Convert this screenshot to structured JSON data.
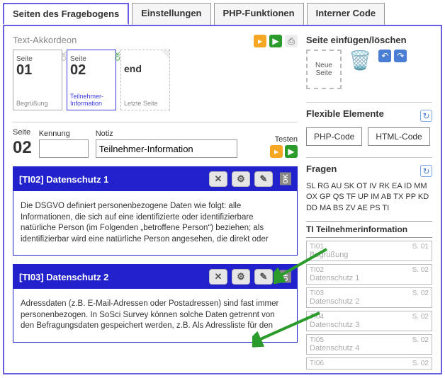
{
  "tabs": [
    "Seiten des Fragebogens",
    "Einstellungen",
    "PHP-Funktionen",
    "Interner Code"
  ],
  "accordion_label": "Text-Akkordeon",
  "pages": [
    {
      "label": "Seite",
      "num": "01",
      "name": "Begrüßung",
      "ok": "OK"
    },
    {
      "label": "Seite",
      "num": "02",
      "name": "Teilnehmer-Information",
      "ok": "OK"
    },
    {
      "label": "end",
      "num": "",
      "name": "Letzte Seite",
      "ok": ""
    }
  ],
  "right_page_title": "Seite einfügen/löschen",
  "new_page": "Neue Seite",
  "editor": {
    "seite_lbl": "Seite",
    "seite_val": "02",
    "kennung_lbl": "Kennung",
    "kennung_val": "",
    "notiz_lbl": "Notiz",
    "notiz_val": "Teilnehmer-Information",
    "testen_lbl": "Testen"
  },
  "blocks": [
    {
      "title": "[TI02] Datenschutz 1",
      "ok": "OK",
      "body": "Die DSGVO definiert personenbezogene Daten wie folgt: alle Informationen, die sich auf eine identifizierte oder identifizierbare natürliche Person (im Folgenden „betroffene Person“) beziehen; als identifizierbar wird eine natürliche Person angesehen, die direkt oder"
    },
    {
      "title": "[TI03] Datenschutz 2",
      "ok": "OK",
      "body": "Adressdaten (z.B. E-Mail-Adressen oder Postadressen) sind fast immer personenbezogen. In SoSci Survey können solche Daten getrennt von den Befragungsdaten gespeichert werden, z.B. Als Adressliste für den"
    }
  ],
  "flex_title": "Flexible Elemente",
  "flex_btns": [
    "PHP-Code",
    "HTML-Code"
  ],
  "fragen_title": "Fragen",
  "codes": "SL RG AU SK OT IV RK EA ID MM OX GP QS TF UP IM AB TX PP KD DD MA BS ZV AE PS TI",
  "qlist_title": "TI Teilnehmerinformation",
  "qitems": [
    {
      "id": "TI01",
      "page": "S. 01",
      "name": "Begrüßung"
    },
    {
      "id": "TI02",
      "page": "S. 02",
      "name": "Datenschutz 1"
    },
    {
      "id": "TI03",
      "page": "S. 02",
      "name": "Datenschutz 2"
    },
    {
      "id": "TI04",
      "page": "S. 02",
      "name": "Datenschutz 3"
    },
    {
      "id": "TI05",
      "page": "S. 02",
      "name": "Datenschutz 4"
    },
    {
      "id": "TI06",
      "page": "S. 02",
      "name": ""
    }
  ]
}
